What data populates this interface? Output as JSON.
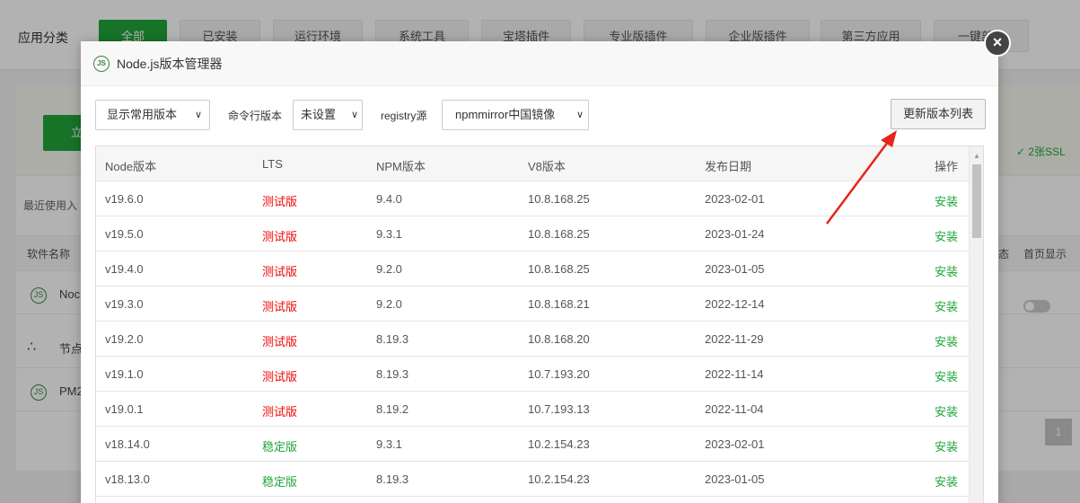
{
  "background": {
    "category_label": "应用分类",
    "categories": [
      "全部",
      "已安装",
      "运行环境",
      "系统工具",
      "宝塔插件",
      "专业版插件",
      "企业版插件",
      "第三方应用",
      "一键部署"
    ],
    "ssl_text": "✓ 2张SSL",
    "recent_label": "最近使用入",
    "table_headers": {
      "name": "软件名称",
      "status": "态",
      "home": "首页显示"
    },
    "rows": [
      "Noc",
      "节点",
      "PM2"
    ],
    "page_number": "1",
    "green_button_fragment": "立"
  },
  "modal": {
    "title": "Node.js版本管理器",
    "icon": "nodejs-icon",
    "close": "×",
    "toolbar": {
      "version_filter": "显示常用版本",
      "cli_label": "命令行版本",
      "cli_value": "未设置",
      "registry_label": "registry源",
      "registry_value": "npmmirror中国镜像",
      "update_button": "更新版本列表"
    },
    "table": {
      "headers": {
        "node": "Node版本",
        "lts": "LTS",
        "npm": "NPM版本",
        "v8": "V8版本",
        "date": "发布日期",
        "action": "操作"
      },
      "rows": [
        {
          "node": "v19.6.0",
          "lts": "测试版",
          "npm": "9.4.0",
          "v8": "10.8.168.25",
          "date": "2023-02-01",
          "action": "安装"
        },
        {
          "node": "v19.5.0",
          "lts": "测试版",
          "npm": "9.3.1",
          "v8": "10.8.168.25",
          "date": "2023-01-24",
          "action": "安装"
        },
        {
          "node": "v19.4.0",
          "lts": "测试版",
          "npm": "9.2.0",
          "v8": "10.8.168.25",
          "date": "2023-01-05",
          "action": "安装"
        },
        {
          "node": "v19.3.0",
          "lts": "测试版",
          "npm": "9.2.0",
          "v8": "10.8.168.21",
          "date": "2022-12-14",
          "action": "安装"
        },
        {
          "node": "v19.2.0",
          "lts": "测试版",
          "npm": "8.19.3",
          "v8": "10.8.168.20",
          "date": "2022-11-29",
          "action": "安装"
        },
        {
          "node": "v19.1.0",
          "lts": "测试版",
          "npm": "8.19.3",
          "v8": "10.7.193.20",
          "date": "2022-11-14",
          "action": "安装"
        },
        {
          "node": "v19.0.1",
          "lts": "测试版",
          "npm": "8.19.2",
          "v8": "10.7.193.13",
          "date": "2022-11-04",
          "action": "安装"
        },
        {
          "node": "v18.14.0",
          "lts": "稳定版",
          "npm": "9.3.1",
          "v8": "10.2.154.23",
          "date": "2023-02-01",
          "action": "安装"
        },
        {
          "node": "v18.13.0",
          "lts": "稳定版",
          "npm": "8.19.3",
          "v8": "10.2.154.23",
          "date": "2023-01-05",
          "action": "安装"
        }
      ]
    }
  },
  "colors": {
    "accent_green": "#20a53a",
    "test_red": "#ef0808",
    "arrow_red": "#e8241a"
  }
}
